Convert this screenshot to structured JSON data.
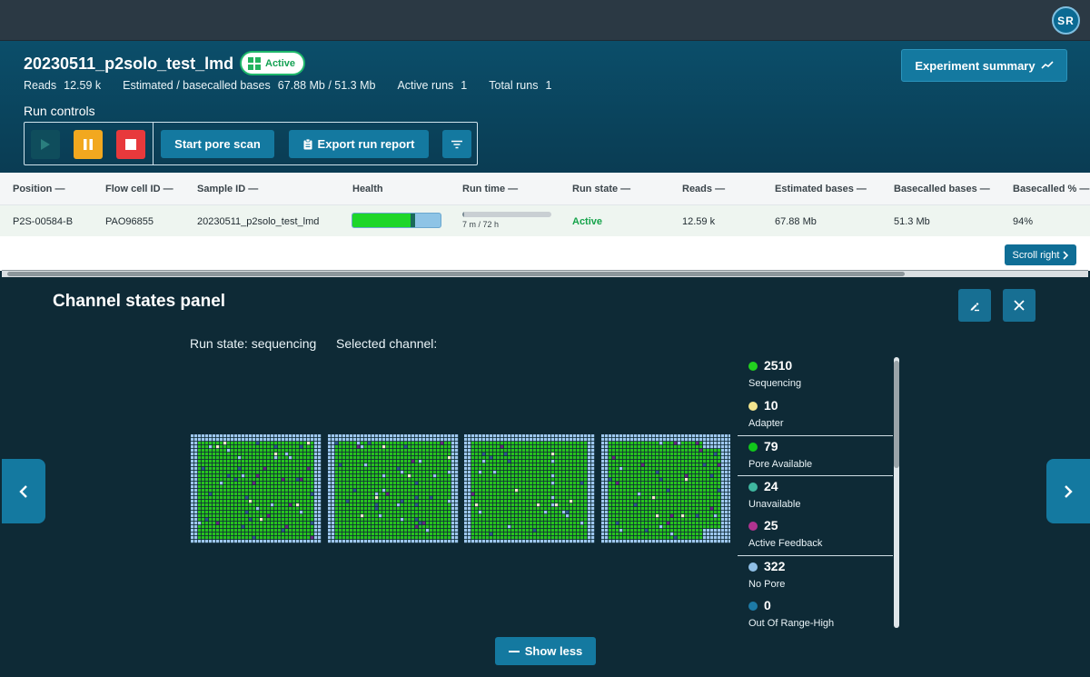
{
  "user": {
    "initials": "SR"
  },
  "experiment": {
    "title": "20230511_p2solo_test_lmd",
    "status": "Active",
    "stats": [
      {
        "label": "Reads",
        "value": "12.59 k"
      },
      {
        "label": "Estimated / basecalled bases",
        "value": "67.88 Mb / 51.3 Mb"
      },
      {
        "label": "Active runs",
        "value": "1"
      },
      {
        "label": "Total runs",
        "value": "1"
      }
    ],
    "summary_button": "Experiment summary"
  },
  "run_controls": {
    "label": "Run controls",
    "start_pore_scan": "Start pore scan",
    "export_run_report": "Export run report"
  },
  "table": {
    "columns": [
      {
        "label": "Position",
        "sortable": true
      },
      {
        "label": "Flow cell ID",
        "sortable": true
      },
      {
        "label": "Sample ID",
        "sortable": true
      },
      {
        "label": "Health",
        "sortable": false
      },
      {
        "label": "Run time",
        "sortable": true
      },
      {
        "label": "Run state",
        "sortable": true
      },
      {
        "label": "Reads",
        "sortable": true
      },
      {
        "label": "Estimated bases",
        "sortable": true
      },
      {
        "label": "Basecalled bases",
        "sortable": true
      },
      {
        "label": "Basecalled %",
        "sortable": true
      }
    ],
    "row": {
      "position": "P2S-00584-B",
      "flow_cell_id": "PAO96855",
      "sample_id": "20230511_p2solo_test_lmd",
      "health_fraction": 0.7,
      "run_time": "7 m / 72 h",
      "run_time_fraction": 0.02,
      "run_state": "Active",
      "reads": "12.59 k",
      "estimated_bases": "67.88 Mb",
      "basecalled_bases": "51.3 Mb",
      "basecalled_pct": "94%"
    },
    "scroll_right": "Scroll right"
  },
  "panel": {
    "title": "Channel states panel",
    "run_state": "Run state: sequencing",
    "selected_channel": "Selected channel:",
    "show_less": "Show less",
    "legend": [
      {
        "count": "2510",
        "name": "Sequencing",
        "color": "#22d11f"
      },
      {
        "count": "10",
        "name": "Adapter",
        "color": "#f2e48e"
      },
      {
        "count": "79",
        "name": "Pore Available",
        "color": "#11c71b"
      },
      {
        "count": "24",
        "name": "Unavailable",
        "color": "#3fb7a0"
      },
      {
        "count": "25",
        "name": "Active Feedback",
        "color": "#b0338f"
      },
      {
        "count": "322",
        "name": "No Pore",
        "color": "#8fbfe6"
      },
      {
        "count": "0",
        "name": "Out Of Range-High",
        "color": "#1d7aa6"
      }
    ]
  },
  "colors": {
    "sequencing": "#27c21e",
    "no_pore": "#9ec7ee",
    "unavailable": "#2f5a8c",
    "adapter": "#f4f0c8",
    "feedback": "#6a2a7d",
    "accent": "#1479a0"
  }
}
